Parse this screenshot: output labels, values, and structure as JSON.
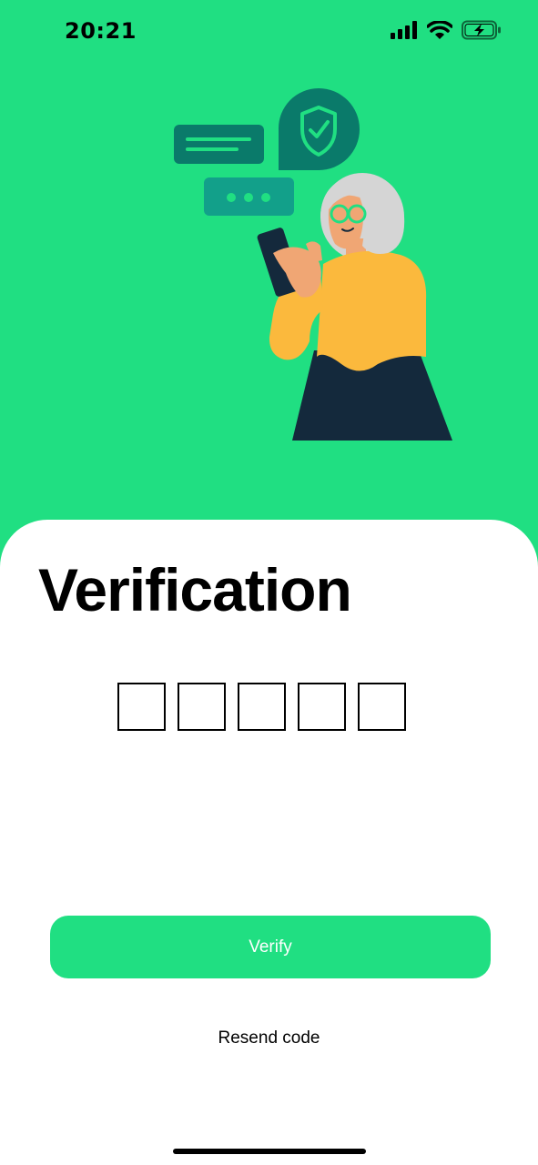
{
  "status_bar": {
    "time": "20:21",
    "icons": [
      "cellular-signal-icon",
      "wifi-icon",
      "battery-charging-icon"
    ]
  },
  "illustration": {
    "subject": "woman-with-phone-illustration",
    "bubbles": [
      "message-bubble-icon",
      "shield-check-icon",
      "typing-dots-bubble-icon"
    ]
  },
  "screen": {
    "title": "Verification",
    "code_length": 5,
    "code_values": [
      "",
      "",
      "",
      "",
      ""
    ],
    "verify_label": "Verify",
    "resend_label": "Resend code"
  },
  "colors": {
    "accent": "#20DF82",
    "dark_teal": "#0A7A6A",
    "teal": "#12A08A",
    "sweater": "#FBB93D",
    "skirt": "#14293C",
    "skin": "#F0A674",
    "hair": "#D5D5D5"
  }
}
